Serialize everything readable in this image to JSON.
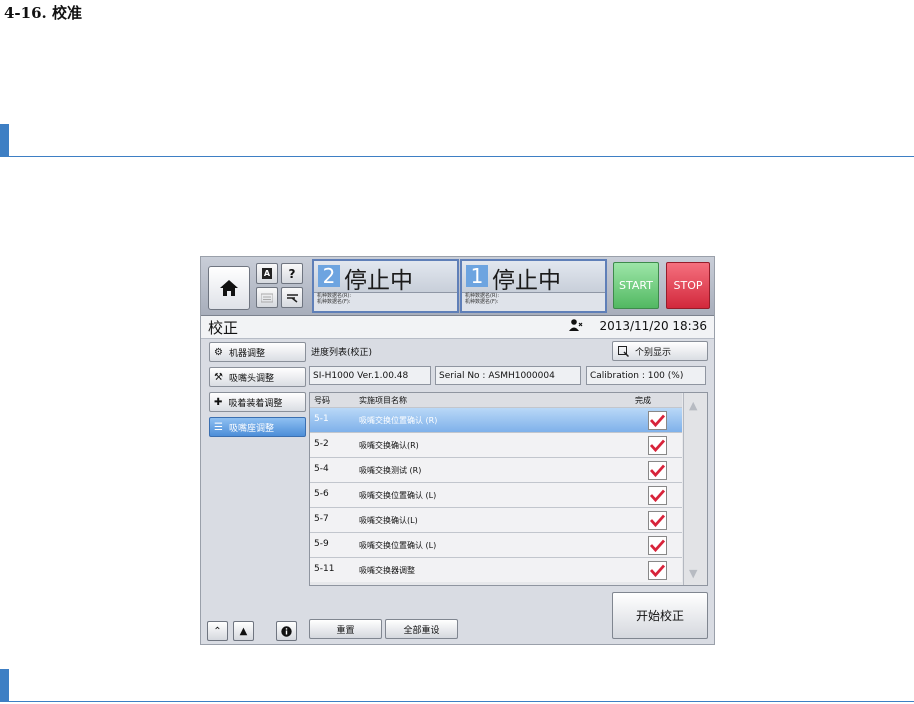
{
  "doc": {
    "heading": "4-16. 校准"
  },
  "topbar": {
    "status1": {
      "number": "2",
      "text": "停止中",
      "line1": "机种数据名(R):",
      "line2": "机种数据名(F):"
    },
    "status2": {
      "number": "1",
      "text": "停止中",
      "line1": "机种数据名(R):",
      "line2": "机种数据名(F):"
    },
    "start_label": "START",
    "stop_label": "STOP",
    "help_label": "?",
    "language_label": "A"
  },
  "titlebar": {
    "title": "校正",
    "datetime": "2013/11/20 18:36"
  },
  "sidebar": {
    "items": [
      {
        "label": "机器调整",
        "active": false
      },
      {
        "label": "吸嘴头调整",
        "active": false
      },
      {
        "label": "吸着装着调整",
        "active": false
      },
      {
        "label": "吸嘴座调整",
        "active": true
      }
    ]
  },
  "main": {
    "list_label": "进度列表(校正)",
    "detail_button": "个别显示",
    "version": "SI-H1000 Ver.1.00.48",
    "serial": "Serial No : ASMH1000004",
    "calibration": "Calibration : 100 (%)",
    "columns": {
      "code": "号码",
      "name": "实施项目名称",
      "done": "完成"
    },
    "rows": [
      {
        "code": "5-1",
        "name": "吸嘴交换位置确认 (R)",
        "done": true
      },
      {
        "code": "5-2",
        "name": "吸嘴交换确认(R)",
        "done": true
      },
      {
        "code": "5-4",
        "name": "吸嘴交换测试 (R)",
        "done": true
      },
      {
        "code": "5-6",
        "name": "吸嘴交换位置确认 (L)",
        "done": true
      },
      {
        "code": "5-7",
        "name": "吸嘴交换确认(L)",
        "done": true
      },
      {
        "code": "5-9",
        "name": "吸嘴交换位置确认 (L)",
        "done": true
      },
      {
        "code": "5-11",
        "name": "吸嘴交换器调整",
        "done": true
      }
    ],
    "reset_label": "重置",
    "reset_all_label": "全部重设",
    "start_calibration_label": "开始校正"
  },
  "colors": {
    "accent": "#3e7fc4",
    "start": "#52b862",
    "stop": "#d2283c",
    "selected_row": "#7fb1ea",
    "check": "#d8233a"
  }
}
